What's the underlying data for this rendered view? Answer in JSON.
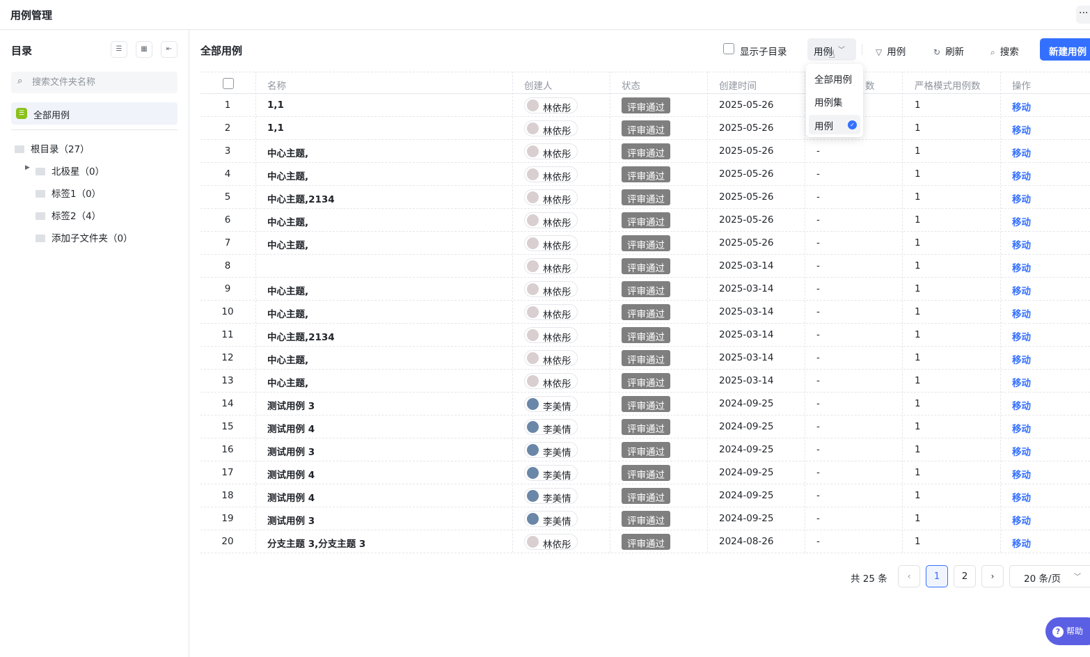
{
  "header": {
    "title": "用例管理",
    "more_label": "···"
  },
  "sidebar": {
    "title": "目录",
    "search_placeholder": "搜索文件夹名称",
    "all_label": "全部用例",
    "tree": [
      {
        "label": "根目录（27）",
        "level": 0,
        "expandable": false
      },
      {
        "label": "北极星（0）",
        "level": 1,
        "expandable": true
      },
      {
        "label": "标签1（0）",
        "level": 1,
        "expandable": false
      },
      {
        "label": "标签2（4）",
        "level": 1,
        "expandable": false
      },
      {
        "label": "添加子文件夹（0）",
        "level": 1,
        "expandable": false
      }
    ]
  },
  "toolbar": {
    "title": "全部用例",
    "show_subdir_label": "显示子目录",
    "type_label": "用例",
    "filter_label": "用例",
    "refresh_label": "刷新",
    "search_label": "搜索",
    "new_label": "新建用例"
  },
  "dropdown": {
    "options": [
      "全部用例",
      "用例集",
      "用例"
    ],
    "selected": "用例"
  },
  "table": {
    "headers": {
      "name": "名称",
      "creator": "创建人",
      "status": "状态",
      "created": "创建时间",
      "count1_tail": "数",
      "count2": "严格模式用例数",
      "ops": "操作"
    },
    "rows": [
      {
        "idx": "1",
        "name": "1,1",
        "creator": "林依彤",
        "avatar": "pink",
        "status": "评审通过",
        "created": "2025-05-26",
        "c1": "",
        "c2": "1",
        "op": "移动"
      },
      {
        "idx": "2",
        "name": "1,1",
        "creator": "林依彤",
        "avatar": "pink",
        "status": "评审通过",
        "created": "2025-05-26",
        "c1": "",
        "c2": "1",
        "op": "移动"
      },
      {
        "idx": "3",
        "name": "中心主题,",
        "creator": "林依彤",
        "avatar": "pink",
        "status": "评审通过",
        "created": "2025-05-26",
        "c1": "-",
        "c2": "1",
        "op": "移动"
      },
      {
        "idx": "4",
        "name": "中心主题,",
        "creator": "林依彤",
        "avatar": "pink",
        "status": "评审通过",
        "created": "2025-05-26",
        "c1": "-",
        "c2": "1",
        "op": "移动"
      },
      {
        "idx": "5",
        "name": "中心主题,2134",
        "creator": "林依彤",
        "avatar": "pink",
        "status": "评审通过",
        "created": "2025-05-26",
        "c1": "-",
        "c2": "1",
        "op": "移动"
      },
      {
        "idx": "6",
        "name": "中心主题,",
        "creator": "林依彤",
        "avatar": "pink",
        "status": "评审通过",
        "created": "2025-05-26",
        "c1": "-",
        "c2": "1",
        "op": "移动"
      },
      {
        "idx": "7",
        "name": "中心主题,",
        "creator": "林依彤",
        "avatar": "pink",
        "status": "评审通过",
        "created": "2025-05-26",
        "c1": "-",
        "c2": "1",
        "op": "移动"
      },
      {
        "idx": "8",
        "name": "",
        "creator": "林依彤",
        "avatar": "pink",
        "status": "评审通过",
        "created": "2025-03-14",
        "c1": "-",
        "c2": "1",
        "op": "移动"
      },
      {
        "idx": "9",
        "name": "中心主题,",
        "creator": "林依彤",
        "avatar": "pink",
        "status": "评审通过",
        "created": "2025-03-14",
        "c1": "-",
        "c2": "1",
        "op": "移动"
      },
      {
        "idx": "10",
        "name": "中心主题,",
        "creator": "林依彤",
        "avatar": "pink",
        "status": "评审通过",
        "created": "2025-03-14",
        "c1": "-",
        "c2": "1",
        "op": "移动"
      },
      {
        "idx": "11",
        "name": "中心主题,2134",
        "creator": "林依彤",
        "avatar": "pink",
        "status": "评审通过",
        "created": "2025-03-14",
        "c1": "-",
        "c2": "1",
        "op": "移动"
      },
      {
        "idx": "12",
        "name": "中心主题,",
        "creator": "林依彤",
        "avatar": "pink",
        "status": "评审通过",
        "created": "2025-03-14",
        "c1": "-",
        "c2": "1",
        "op": "移动"
      },
      {
        "idx": "13",
        "name": "中心主题,",
        "creator": "林依彤",
        "avatar": "pink",
        "status": "评审通过",
        "created": "2025-03-14",
        "c1": "-",
        "c2": "1",
        "op": "移动"
      },
      {
        "idx": "14",
        "name": "测试用例 3",
        "creator": "李美情",
        "avatar": "blue",
        "status": "评审通过",
        "created": "2024-09-25",
        "c1": "-",
        "c2": "1",
        "op": "移动"
      },
      {
        "idx": "15",
        "name": "测试用例 4",
        "creator": "李美情",
        "avatar": "blue",
        "status": "评审通过",
        "created": "2024-09-25",
        "c1": "-",
        "c2": "1",
        "op": "移动"
      },
      {
        "idx": "16",
        "name": "测试用例 3",
        "creator": "李美情",
        "avatar": "blue",
        "status": "评审通过",
        "created": "2024-09-25",
        "c1": "-",
        "c2": "1",
        "op": "移动"
      },
      {
        "idx": "17",
        "name": "测试用例 4",
        "creator": "李美情",
        "avatar": "blue",
        "status": "评审通过",
        "created": "2024-09-25",
        "c1": "-",
        "c2": "1",
        "op": "移动"
      },
      {
        "idx": "18",
        "name": "测试用例 4",
        "creator": "李美情",
        "avatar": "blue",
        "status": "评审通过",
        "created": "2024-09-25",
        "c1": "-",
        "c2": "1",
        "op": "移动"
      },
      {
        "idx": "19",
        "name": "测试用例 3",
        "creator": "李美情",
        "avatar": "blue",
        "status": "评审通过",
        "created": "2024-09-25",
        "c1": "-",
        "c2": "1",
        "op": "移动"
      },
      {
        "idx": "20",
        "name": "分支主题 3,分支主题 3",
        "creator": "林依彤",
        "avatar": "pink",
        "status": "评审通过",
        "created": "2024-08-26",
        "c1": "-",
        "c2": "1",
        "op": "移动"
      }
    ]
  },
  "pagination": {
    "total_label": "共 25 条",
    "pages": [
      "1",
      "2"
    ],
    "current": "1",
    "page_size_label": "20 条/页"
  },
  "help": {
    "label": "帮助"
  },
  "colors": {
    "accent": "#3370ff",
    "status_bg": "#7f7f7f",
    "help_bg": "#5b5fe3"
  }
}
